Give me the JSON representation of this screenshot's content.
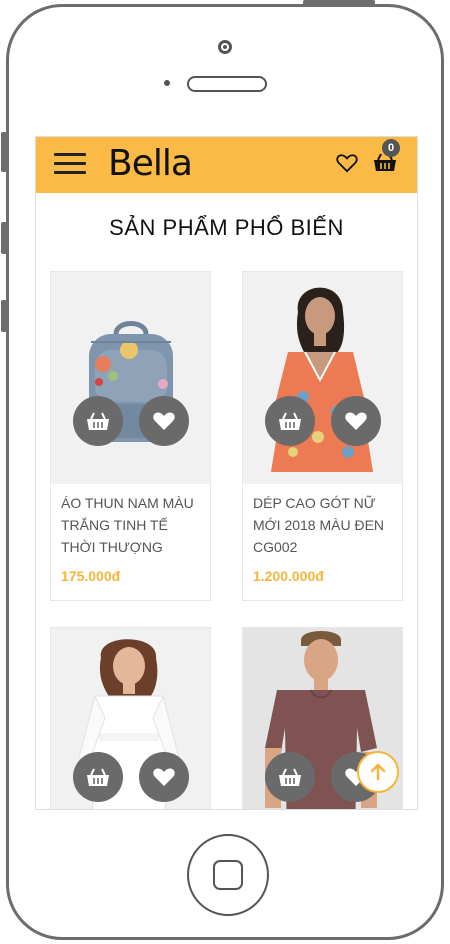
{
  "app": {
    "brand": "Bella",
    "cart_count": "0"
  },
  "section": {
    "title": "SẢN PHẨM PHỔ BIẾN"
  },
  "products": [
    {
      "title": "ÁO THUN NAM MÀU TRẮNG TINH TẾ THỜI THƯỢNG",
      "price": "175.000đ",
      "image": "backpack"
    },
    {
      "title": "DÉP CAO GÓT NỮ MỚI 2018 MÀU ĐEN CG002",
      "price": "1.200.000đ",
      "image": "floral-dress"
    },
    {
      "title": "",
      "price": "",
      "image": "white-lace-dress"
    },
    {
      "title": "",
      "price": "",
      "image": "maroon-tshirt"
    }
  ],
  "colors": {
    "header": "#fbba45",
    "accent": "#f5b53a",
    "button": "#6a6a6a"
  },
  "icons": {
    "menu": "hamburger-icon",
    "wishlist": "heart-icon",
    "cart": "basket-icon",
    "scroll_top": "arrow-up-icon"
  }
}
